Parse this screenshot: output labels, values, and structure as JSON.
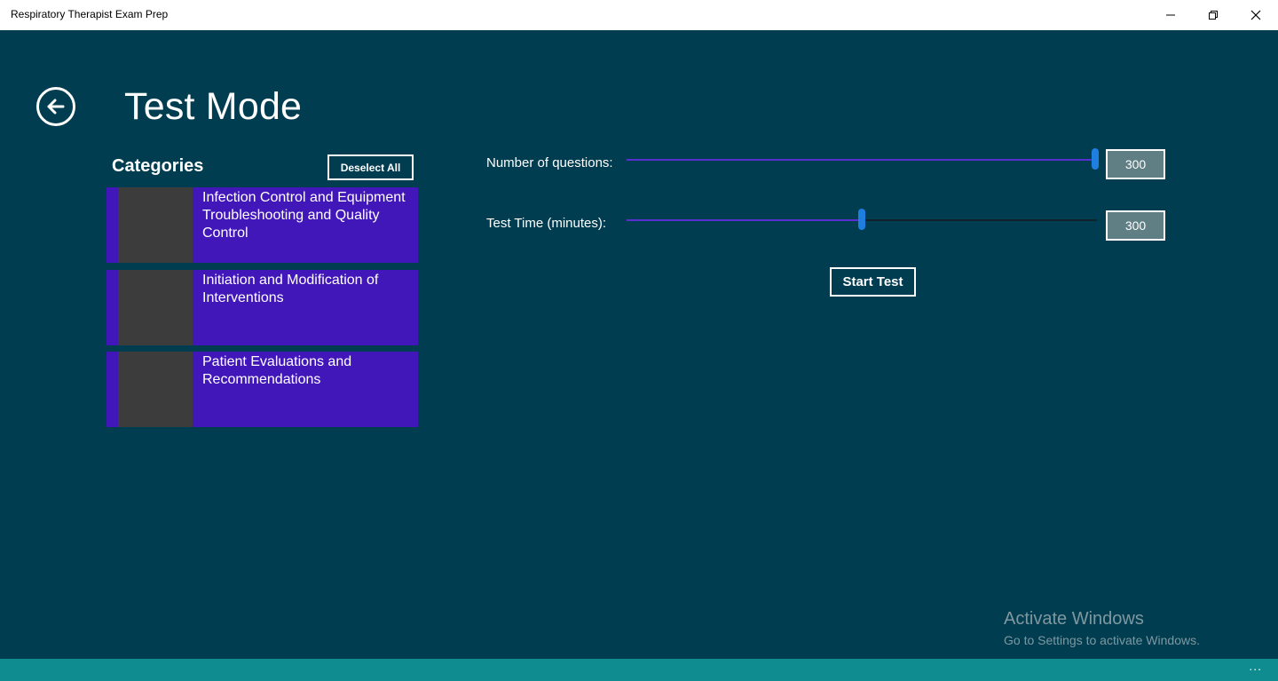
{
  "window": {
    "title": "Respiratory Therapist Exam Prep",
    "controls": {
      "minimize": "—",
      "maximize": "❐",
      "close": "✕"
    }
  },
  "header": {
    "title": "Test Mode",
    "back_icon": "back-arrow-icon"
  },
  "categories": {
    "heading": "Categories",
    "deselect_label": "Deselect All",
    "items": [
      {
        "label": "Infection Control and Equipment Troubleshooting and Quality Control"
      },
      {
        "label": "Initiation and Modification of Interventions"
      },
      {
        "label": "Patient Evaluations and Recommendations"
      }
    ]
  },
  "settings": {
    "questions": {
      "label": "Number of questions:",
      "value": "300",
      "slider_level": 1.0
    },
    "time": {
      "label": "Test Time (minutes):",
      "value": "300",
      "slider_level": 0.5
    },
    "start_label": "Start Test"
  },
  "watermark": {
    "title": "Activate Windows",
    "subtitle": "Go to Settings to activate Windows."
  },
  "appbar": {
    "more": "..."
  },
  "colors": {
    "background": "#013d50",
    "category_tile": "#4217ba",
    "slider_fill": "#5a2fd0",
    "slider_thumb": "#1e7fe0",
    "app_bar": "#0f8c8f"
  }
}
